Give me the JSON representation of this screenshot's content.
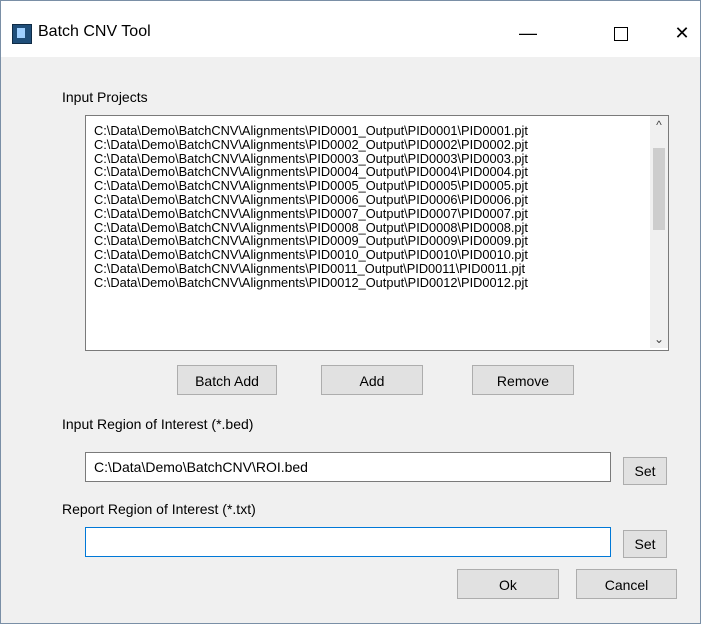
{
  "window": {
    "title": "Batch CNV Tool",
    "controls": {
      "minimize": "—",
      "maximize": "□",
      "close": "✕"
    }
  },
  "input_projects": {
    "label": "Input Projects",
    "items": [
      "C:\\Data\\Demo\\BatchCNV\\Alignments\\PID0001_Output\\PID0001\\PID0001.pjt",
      "C:\\Data\\Demo\\BatchCNV\\Alignments\\PID0002_Output\\PID0002\\PID0002.pjt",
      "C:\\Data\\Demo\\BatchCNV\\Alignments\\PID0003_Output\\PID0003\\PID0003.pjt",
      "C:\\Data\\Demo\\BatchCNV\\Alignments\\PID0004_Output\\PID0004\\PID0004.pjt",
      "C:\\Data\\Demo\\BatchCNV\\Alignments\\PID0005_Output\\PID0005\\PID0005.pjt",
      "C:\\Data\\Demo\\BatchCNV\\Alignments\\PID0006_Output\\PID0006\\PID0006.pjt",
      "C:\\Data\\Demo\\BatchCNV\\Alignments\\PID0007_Output\\PID0007\\PID0007.pjt",
      "C:\\Data\\Demo\\BatchCNV\\Alignments\\PID0008_Output\\PID0008\\PID0008.pjt",
      "C:\\Data\\Demo\\BatchCNV\\Alignments\\PID0009_Output\\PID0009\\PID0009.pjt",
      "C:\\Data\\Demo\\BatchCNV\\Alignments\\PID0010_Output\\PID0010\\PID0010.pjt",
      "C:\\Data\\Demo\\BatchCNV\\Alignments\\PID0011_Output\\PID0011\\PID0011.pjt",
      "C:\\Data\\Demo\\BatchCNV\\Alignments\\PID0012_Output\\PID0012\\PID0012.pjt"
    ]
  },
  "buttons": {
    "batch_add": "Batch Add",
    "add": "Add",
    "remove": "Remove",
    "set_roi": "Set",
    "set_report": "Set",
    "ok": "Ok",
    "cancel": "Cancel"
  },
  "roi": {
    "label": "Input Region of Interest (*.bed)",
    "value": "C:\\Data\\Demo\\BatchCNV\\ROI.bed"
  },
  "report": {
    "label": "Report Region of Interest (*.txt)",
    "value": ""
  },
  "colors": {
    "accent_focus": "#0078d7",
    "dialog_bg": "#f0f0f0"
  }
}
